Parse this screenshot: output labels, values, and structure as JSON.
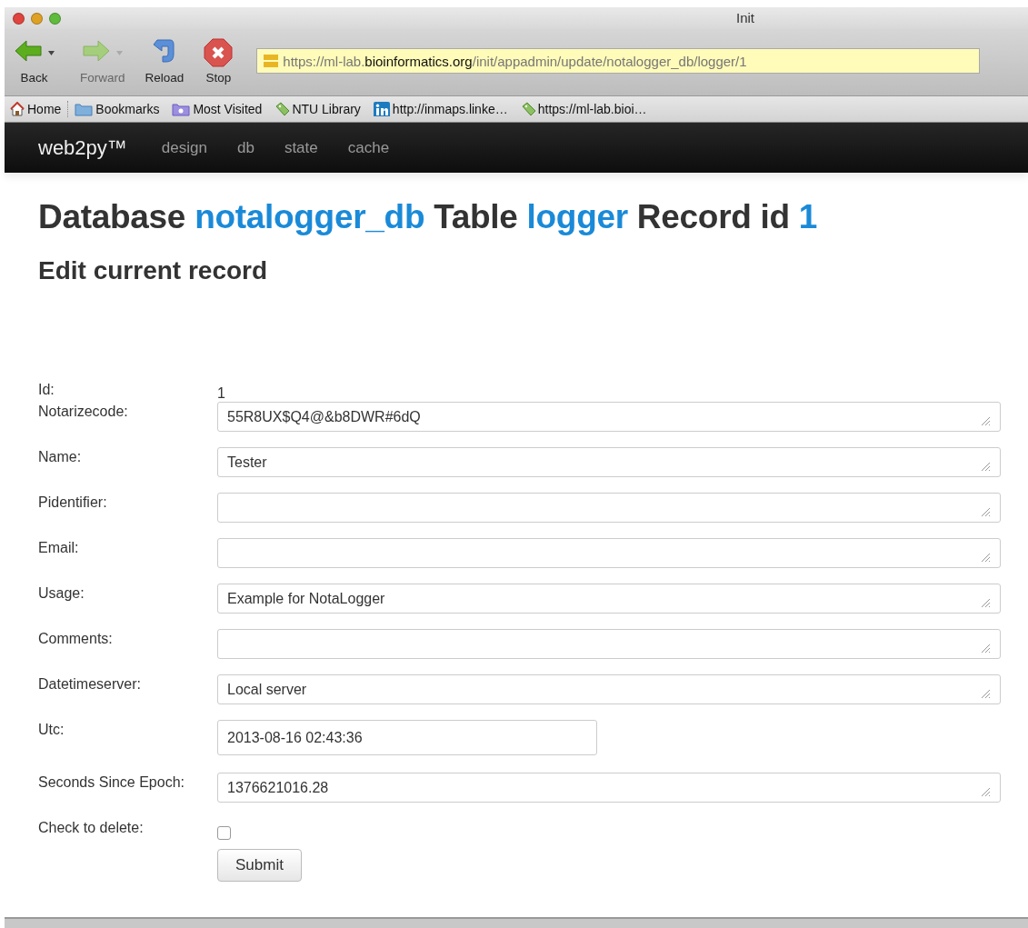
{
  "window": {
    "title": "Init"
  },
  "toolbar": [
    {
      "label": "Back",
      "kind": "back",
      "disabled": false,
      "menu": true
    },
    {
      "label": "Forward",
      "kind": "forward",
      "disabled": true,
      "menu": true
    },
    {
      "label": "Reload",
      "kind": "reload",
      "disabled": false,
      "menu": false
    },
    {
      "label": "Stop",
      "kind": "stop",
      "disabled": false,
      "menu": false
    }
  ],
  "address": {
    "parts": [
      {
        "text": "https://ml-lab.",
        "emphasis": false
      },
      {
        "text": "bioinformatics.org",
        "emphasis": true
      },
      {
        "text": "/init/appadmin/update/notalogger_db/logger/1",
        "emphasis": false
      }
    ]
  },
  "bookmarks": [
    {
      "label": "Home",
      "kind": "home"
    },
    {
      "label": "Bookmarks",
      "kind": "folder"
    },
    {
      "label": "Most Visited",
      "kind": "smart"
    },
    {
      "label": "NTU Library",
      "kind": "tag"
    },
    {
      "label": "http://inmaps.linke…",
      "kind": "linkedin"
    },
    {
      "label": "https://ml-lab.bioi…",
      "kind": "tag"
    }
  ],
  "navbar": {
    "brand": "web2py™",
    "items": [
      "design",
      "db",
      "state",
      "cache"
    ]
  },
  "heading": [
    {
      "text": "Database",
      "kind": "plain"
    },
    {
      "text": "notalogger_db",
      "kind": "link"
    },
    {
      "text": "Table",
      "kind": "plain"
    },
    {
      "text": "logger",
      "kind": "link"
    },
    {
      "text": "Record id",
      "kind": "plain"
    },
    {
      "text": "1",
      "kind": "link"
    }
  ],
  "subheading": "Edit current record",
  "fields": [
    {
      "label": "Id:",
      "kind": "static",
      "value": "1"
    },
    {
      "label": "Notarizecode:",
      "kind": "textarea",
      "value": "55R8UX$Q4@&b8DWR#6dQ"
    },
    {
      "label": "Name:",
      "kind": "textarea",
      "value": "Tester"
    },
    {
      "label": "Pidentifier:",
      "kind": "textarea"
    },
    {
      "label": "Email:",
      "kind": "textarea"
    },
    {
      "label": "Usage:",
      "kind": "textarea",
      "value": "Example for NotaLogger"
    },
    {
      "label": "Comments:",
      "kind": "textarea"
    },
    {
      "label": "Datetimeserver:",
      "kind": "textarea",
      "value": "Local server"
    },
    {
      "label": "Utc:",
      "kind": "input",
      "value": "2013-08-16 02:43:36"
    },
    {
      "label": "Seconds Since Epoch:",
      "kind": "textarea",
      "value": "1376621016.28"
    },
    {
      "label": "Check to delete:",
      "kind": "checkbox",
      "checked": false
    }
  ],
  "submit": "Submit"
}
